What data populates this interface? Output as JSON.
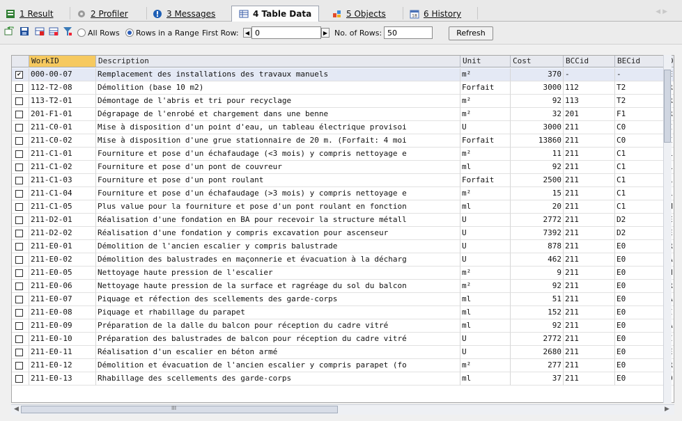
{
  "tabs": [
    {
      "label": "1 Result"
    },
    {
      "label": "2 Profiler"
    },
    {
      "label": "3 Messages"
    },
    {
      "label": "4 Table Data"
    },
    {
      "label": "5 Objects"
    },
    {
      "label": "6 History"
    }
  ],
  "toolbar": {
    "all_rows_label": "All Rows",
    "rows_range_label": "Rows in a Range",
    "first_row_label": "First Row:",
    "first_row_value": "0",
    "num_rows_label": "No. of Rows:",
    "num_rows_value": "50",
    "refresh_label": "Refresh"
  },
  "table": {
    "columns": [
      "WorkID",
      "Description",
      "Unit",
      "Cost",
      "BCCid",
      "BECid",
      "D"
    ],
    "rows": [
      {
        "checked": true,
        "workid": "000-00-07",
        "desc": "Remplacement des installations des travaux manuels",
        "unit": "m²",
        "cost": "370",
        "bcc": "-",
        "bec": "-",
        "d": "E"
      },
      {
        "checked": false,
        "workid": "112-T2-08",
        "desc": "Démolition (base 10 m2)",
        "unit": "Forfait",
        "cost": "3000",
        "bcc": "112",
        "bec": "T2",
        "d": "R"
      },
      {
        "checked": false,
        "workid": "113-T2-01",
        "desc": "Démontage de l'abris et tri pour recyclage",
        "unit": "m²",
        "cost": "92",
        "bcc": "113",
        "bec": "T2",
        "d": "R"
      },
      {
        "checked": false,
        "workid": "201-F1-01",
        "desc": "Dégrapage de l'enrobé et chargement dans une benne",
        "unit": "m²",
        "cost": "32",
        "bcc": "201",
        "bec": "F1",
        "d": "R"
      },
      {
        "checked": false,
        "workid": "211-C0-01",
        "desc": "Mise à disposition d'un point d'eau, un tableau électrique provisoi",
        "unit": "U",
        "cost": "3000",
        "bcc": "211",
        "bec": "C0",
        "d": "I"
      },
      {
        "checked": false,
        "workid": "211-C0-02",
        "desc": "Mise à disposition d'une grue stationnaire de 20 m. (Forfait: 4 moi",
        "unit": "Forfait",
        "cost": "13860",
        "bcc": "211",
        "bec": "C0",
        "d": "I"
      },
      {
        "checked": false,
        "workid": "211-C1-01",
        "desc": "Fourniture et pose d'un échafaudage (<3 mois) y compris nettoyage e",
        "unit": "m²",
        "cost": "11",
        "bcc": "211",
        "bec": "C1",
        "d": "L"
      },
      {
        "checked": false,
        "workid": "211-C1-02",
        "desc": "Fourniture et pose d'un pont de couvreur",
        "unit": "ml",
        "cost": "92",
        "bcc": "211",
        "bec": "C1",
        "d": "L"
      },
      {
        "checked": false,
        "workid": "211-C1-03",
        "desc": "Fourniture et pose d'un pont roulant",
        "unit": "Forfait",
        "cost": "2500",
        "bcc": "211",
        "bec": "C1",
        "d": "L"
      },
      {
        "checked": false,
        "workid": "211-C1-04",
        "desc": "Fourniture et pose d'un échafaudage (>3 mois) y compris nettoyage e",
        "unit": "m²",
        "cost": "15",
        "bcc": "211",
        "bec": "C1",
        "d": "L"
      },
      {
        "checked": false,
        "workid": "211-C1-05",
        "desc": "Plus value pour la fourniture et pose d'un pont roulant en fonction",
        "unit": "ml",
        "cost": "20",
        "bcc": "211",
        "bec": "C1",
        "d": "M"
      },
      {
        "checked": false,
        "workid": "211-D2-01",
        "desc": "Réalisation d'une fondation en BA pour recevoir la structure métall",
        "unit": "U",
        "cost": "2772",
        "bcc": "211",
        "bec": "D2",
        "d": "E"
      },
      {
        "checked": false,
        "workid": "211-D2-02",
        "desc": "Réalisation d'une fondation y compris excavation pour ascenseur",
        "unit": "U",
        "cost": "7392",
        "bcc": "211",
        "bec": "D2",
        "d": "E"
      },
      {
        "checked": false,
        "workid": "211-E0-01",
        "desc": "Démolition de l'ancien escalier y compris balustrade",
        "unit": "U",
        "cost": "878",
        "bcc": "211",
        "bec": "E0",
        "d": "R"
      },
      {
        "checked": false,
        "workid": "211-E0-02",
        "desc": "Démolition des balustrades en maçonnerie et évacuation à la décharg",
        "unit": "U",
        "cost": "462",
        "bcc": "211",
        "bec": "E0",
        "d": "A"
      },
      {
        "checked": false,
        "workid": "211-E0-05",
        "desc": "Nettoyage haute pression de l'escalier",
        "unit": "m²",
        "cost": "9",
        "bcc": "211",
        "bec": "E0",
        "d": "H"
      },
      {
        "checked": false,
        "workid": "211-E0-06",
        "desc": "Nettoyage haute pression de la surface et ragréage du sol du balcon",
        "unit": "m²",
        "cost": "92",
        "bcc": "211",
        "bec": "E0",
        "d": "R"
      },
      {
        "checked": false,
        "workid": "211-E0-07",
        "desc": "Piquage et réfection des scellements des garde-corps",
        "unit": "ml",
        "cost": "51",
        "bcc": "211",
        "bec": "E0",
        "d": "A"
      },
      {
        "checked": false,
        "workid": "211-E0-08",
        "desc": "Piquage et rhabillage du parapet",
        "unit": "ml",
        "cost": "152",
        "bcc": "211",
        "bec": "E0",
        "d": "I"
      },
      {
        "checked": false,
        "workid": "211-E0-09",
        "desc": "Préparation de la dalle du balcon pour réception du cadre vitré",
        "unit": "ml",
        "cost": "92",
        "bcc": "211",
        "bec": "E0",
        "d": "A"
      },
      {
        "checked": false,
        "workid": "211-E0-10",
        "desc": "Préparation des balustrades de balcon pour réception du cadre vitré",
        "unit": "U",
        "cost": "2772",
        "bcc": "211",
        "bec": "E0",
        "d": "I"
      },
      {
        "checked": false,
        "workid": "211-E0-11",
        "desc": "Réalisation d'un escalier en béton armé",
        "unit": "U",
        "cost": "2680",
        "bcc": "211",
        "bec": "E0",
        "d": "E"
      },
      {
        "checked": false,
        "workid": "211-E0-12",
        "desc": "Démolition et évacuation de l'ancien escalier y compris parapet (fo",
        "unit": "m²",
        "cost": "277",
        "bcc": "211",
        "bec": "E0",
        "d": "R"
      },
      {
        "checked": false,
        "workid": "211-E0-13",
        "desc": "Rhabillage des scellements des garde-corps",
        "unit": "ml",
        "cost": "37",
        "bcc": "211",
        "bec": "E0",
        "d": "Ö"
      }
    ]
  },
  "colors": {
    "selected_header": "#f6c95f",
    "selected_row": "#e4e9f5",
    "header_bg": "#e7e9ef"
  },
  "icons": [
    "result-icon",
    "profiler-icon",
    "messages-icon",
    "table-data-icon",
    "objects-icon",
    "history-icon"
  ],
  "hscroll_label": "III"
}
